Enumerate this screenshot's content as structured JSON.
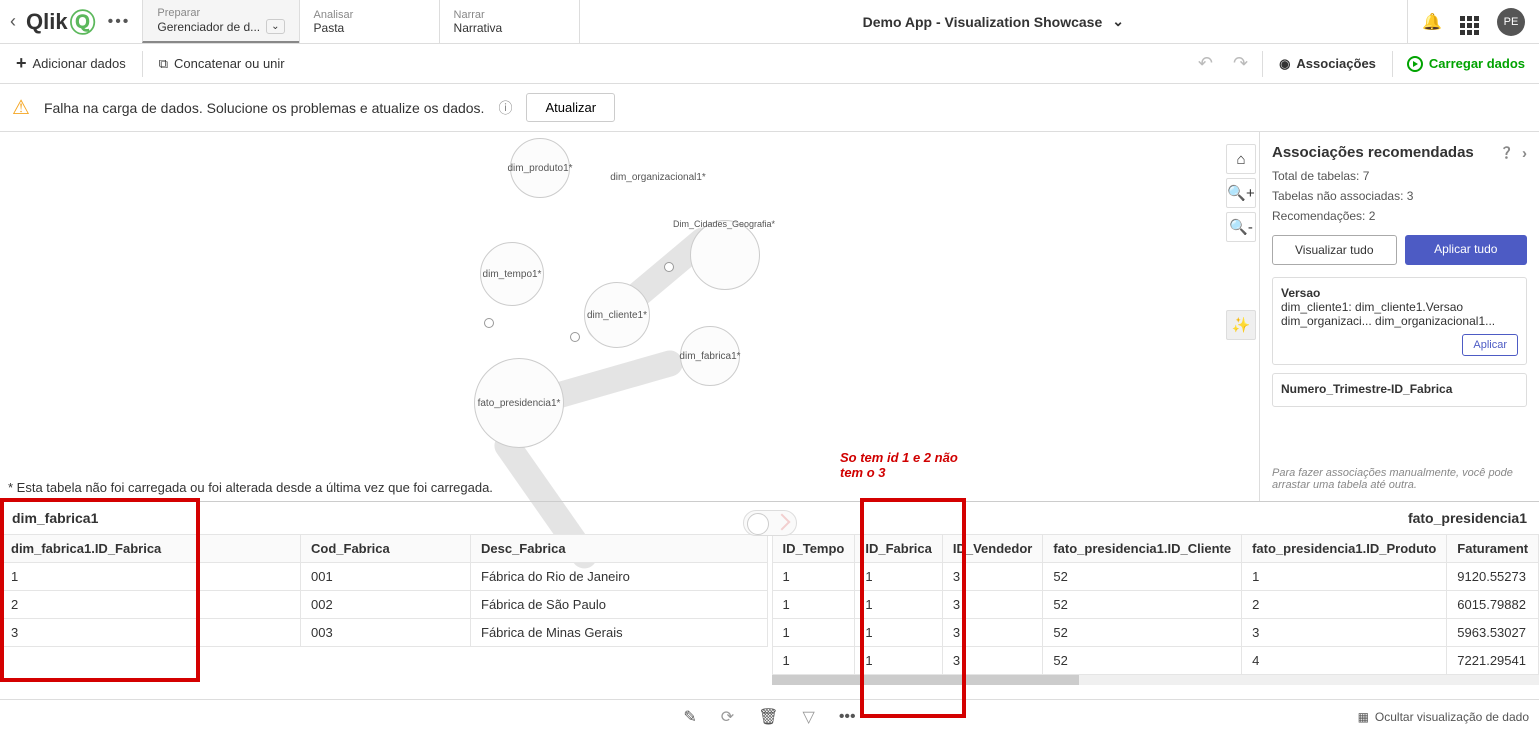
{
  "topbar": {
    "back_glyph": "‹",
    "logo_text": "Qlik",
    "more_glyph": "•••",
    "tabs": [
      {
        "top": "Preparar",
        "bottom": "Gerenciador de d..."
      },
      {
        "top": "Analisar",
        "bottom": "Pasta"
      },
      {
        "top": "Narrar",
        "bottom": "Narrativa"
      }
    ],
    "app_title": "Demo App - Visualization Showcase",
    "avatar": "PE"
  },
  "actionbar": {
    "add_data": "Adicionar dados",
    "concat": "Concatenar ou unir",
    "assoc": "Associações",
    "load": "Carregar dados"
  },
  "warn": {
    "msg": "Falha na carga de dados. Solucione os problemas e atualize os dados.",
    "btn": "Atualizar"
  },
  "bubbles": {
    "produto": "dim_produto1*",
    "org": "dim_organizacional1*",
    "tempo": "dim_tempo1*",
    "cidades": "Dim_Cidades_Geografia*",
    "cliente": "dim_cliente1*",
    "fabrica": "dim_fabrica1*",
    "fato": "fato_presidencia1*"
  },
  "table_note": "* Esta tabela não foi carregada ou foi alterada desde a última vez que foi carregada.",
  "annotation": {
    "l1": "So tem id 1 e 2 não",
    "l2": "tem o 3"
  },
  "side": {
    "title": "Associações recomendadas",
    "total": "Total de tabelas: 7",
    "unassoc": "Tabelas não associadas: 3",
    "recs": "Recomendações: 2",
    "view_all": "Visualizar tudo",
    "apply_all": "Aplicar tudo",
    "rec1_title": "Versao",
    "rec1_l1": "dim_cliente1: dim_cliente1.Versao",
    "rec1_l2": "dim_organizaci...  dim_organizacional1...",
    "apply": "Aplicar",
    "rec2_title": "Numero_Trimestre-ID_Fabrica",
    "hint": "Para fazer associações manualmente, você pode arrastar uma tabela até outra."
  },
  "left_table": {
    "name": "dim_fabrica1",
    "headers": [
      "dim_fabrica1.ID_Fabrica",
      "Cod_Fabrica",
      "Desc_Fabrica"
    ],
    "rows": [
      [
        "1",
        "001",
        "Fábrica do Rio de Janeiro"
      ],
      [
        "2",
        "002",
        "Fábrica de São Paulo"
      ],
      [
        "3",
        "003",
        "Fábrica de Minas Gerais"
      ]
    ]
  },
  "right_table": {
    "name": "fato_presidencia1",
    "headers": [
      "ID_Tempo",
      "ID_Fabrica",
      "ID_Vendedor",
      "fato_presidencia1.ID_Cliente",
      "fato_presidencia1.ID_Produto",
      "Faturament"
    ],
    "rows": [
      [
        "1",
        "1",
        "3",
        "52",
        "1",
        "9120.55273"
      ],
      [
        "1",
        "1",
        "3",
        "52",
        "2",
        "6015.79882"
      ],
      [
        "1",
        "1",
        "3",
        "52",
        "3",
        "5963.53027"
      ],
      [
        "1",
        "1",
        "3",
        "52",
        "4",
        "7221.29541"
      ]
    ]
  },
  "footer": {
    "hide": "Ocultar visualização de dado"
  }
}
